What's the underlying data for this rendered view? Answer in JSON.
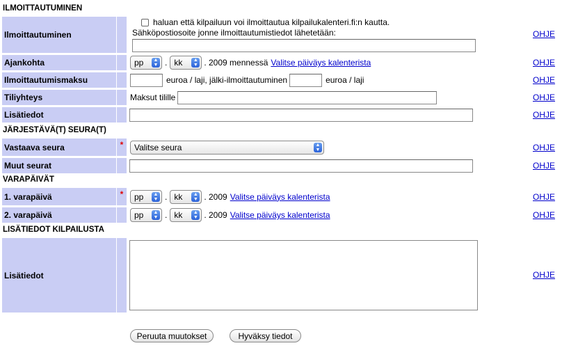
{
  "sections": {
    "registration": "ILMOITTAUTUMINEN",
    "organizer": "JÄRJESTÄVÄ(T) SEURA(T)",
    "backup_days": "VARAPÄIVÄT",
    "extra_info": "LISÄTIEDOT KILPAILUSTA"
  },
  "rows": {
    "registration": {
      "label": "Ilmoittautuminen",
      "checkbox_label": "haluan että kilpailuun voi ilmoittautua kilpailukalenteri.fi:n kautta.",
      "email_label": "Sähköpostiosoite jonne ilmoittautumistiedot lähetetään:",
      "email_value": ""
    },
    "deadline": {
      "label": "Ajankohta",
      "day": "pp",
      "month": "kk",
      "year_text": ". 2009 mennessä",
      "calendar_link": "Valitse päiväys kalenterista"
    },
    "fee": {
      "label": "Ilmoittautumismaksu",
      "text1": "euroa / laji, jälki-ilmoittautuminen",
      "text2": "euroa / laji"
    },
    "account": {
      "label": "Tiliyhteys",
      "prefix": "Maksut tilille"
    },
    "info": {
      "label": "Lisätiedot"
    },
    "club": {
      "label": "Vastaava seura",
      "select_value": "Valitse seura",
      "required": "*"
    },
    "other_clubs": {
      "label": "Muut seurat"
    },
    "backup1": {
      "label": "1. varapäivä",
      "day": "pp",
      "month": "kk",
      "year_text": ". 2009",
      "calendar_link": "Valitse päiväys kalenterista",
      "required": "*"
    },
    "backup2": {
      "label": "2. varapäivä",
      "day": "pp",
      "month": "kk",
      "year_text": ". 2009",
      "calendar_link": "Valitse päiväys kalenterista"
    },
    "extra": {
      "label": "Lisätiedot"
    }
  },
  "help_link": "OHJE",
  "dot": ".",
  "buttons": {
    "cancel": "Peruuta muutokset",
    "accept": "Hyväksy tiedot"
  }
}
